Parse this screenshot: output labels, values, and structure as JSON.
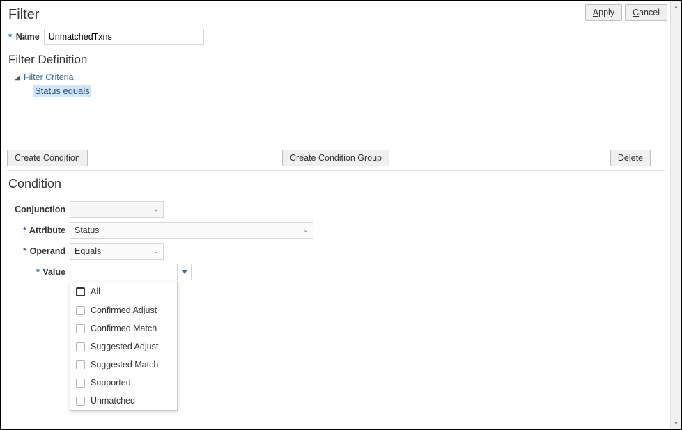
{
  "header": {
    "title": "Filter",
    "apply_label": "Apply",
    "cancel_label": "Cancel"
  },
  "name_field": {
    "label": "Name",
    "value": "UnmatchedTxns"
  },
  "definition": {
    "title": "Filter Definition",
    "root_label": "Filter Criteria",
    "selected_node": "Status equals"
  },
  "actions": {
    "create_condition": "Create Condition",
    "create_condition_group": "Create Condition Group",
    "delete": "Delete"
  },
  "condition": {
    "title": "Condition",
    "conjunction_label": "Conjunction",
    "conjunction_value": "",
    "attribute_label": "Attribute",
    "attribute_value": "Status",
    "operand_label": "Operand",
    "operand_value": "Equals",
    "value_label": "Value",
    "value_value": "",
    "options": [
      "All",
      "Confirmed Adjust",
      "Confirmed Match",
      "Suggested Adjust",
      "Suggested Match",
      "Supported",
      "Unmatched"
    ]
  }
}
